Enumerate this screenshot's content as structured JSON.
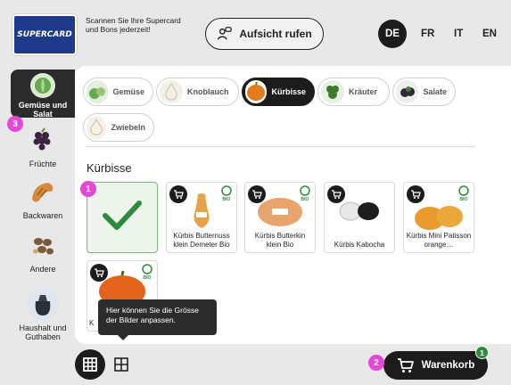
{
  "header": {
    "logo_text": "SUPERCARD",
    "scan_hint": "Scannen Sie Ihre Supercard und Bons jederzeit!",
    "call_button": "Aufsicht rufen",
    "languages": [
      {
        "code": "DE",
        "active": true
      },
      {
        "code": "FR",
        "active": false
      },
      {
        "code": "IT",
        "active": false
      },
      {
        "code": "EN",
        "active": false
      }
    ]
  },
  "sidebar": {
    "items": [
      {
        "label": "Gemüse und Salat",
        "icon": "lettuce-icon",
        "active": true
      },
      {
        "label": "Früchte",
        "icon": "grapes-icon",
        "active": false
      },
      {
        "label": "Backwaren",
        "icon": "croissant-icon",
        "active": false
      },
      {
        "label": "Andere",
        "icon": "nuts-icon",
        "active": false
      },
      {
        "label": "Haushalt und Guthaben",
        "icon": "trash-bag-icon",
        "active": false
      }
    ]
  },
  "subcategories": [
    {
      "label": "Gemüse",
      "active": false
    },
    {
      "label": "Knoblauch",
      "active": false
    },
    {
      "label": "Kürbisse",
      "active": true
    },
    {
      "label": "Kräuter",
      "active": false
    },
    {
      "label": "Salate",
      "active": false
    },
    {
      "label": "Zwiebeln",
      "active": false
    }
  ],
  "section_title": "Kürbisse",
  "products": [
    {
      "name": "",
      "selected": true
    },
    {
      "name": "Kürbis Butternuss klein Demeter Bio",
      "bio": true
    },
    {
      "name": "Kürbis Butterkin klein Bio",
      "bio": true
    },
    {
      "name": "Kürbis Kabocha",
      "bio": false
    },
    {
      "name": "Kürbis Mini Patisson orange…",
      "bio": true
    },
    {
      "name": "K",
      "bio": true
    }
  ],
  "tooltip": "Hier können Sie die Grösse der Bilder anpassen.",
  "badges": {
    "one": "1",
    "two": "2",
    "three": "3"
  },
  "cart": {
    "label": "Warenkorb",
    "count": "1"
  },
  "colors": {
    "accent": "#1c1c1c",
    "badge": "#e548d8",
    "bio": "#2e8b3e",
    "logo": "#1f3a8a"
  }
}
